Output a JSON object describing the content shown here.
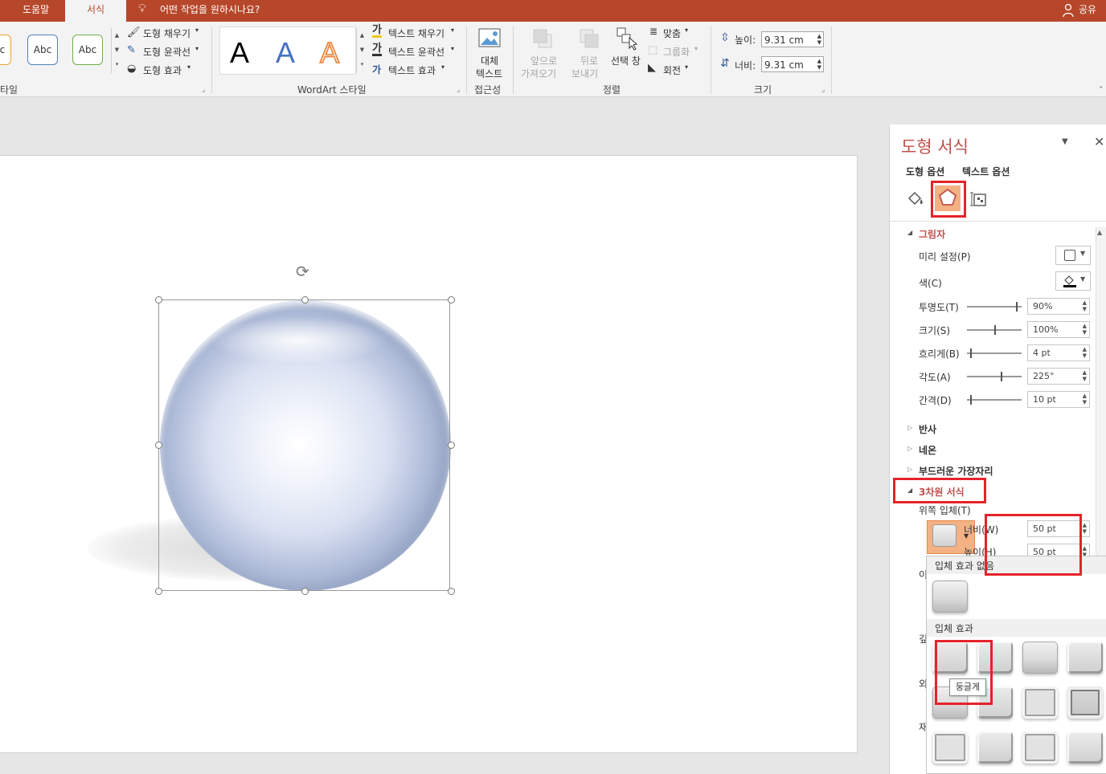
{
  "tabs": [
    "도움말",
    "서식"
  ],
  "search": {
    "placeholder": "어떤 작업을 원하시나요?"
  },
  "share_label": "공유",
  "ribbon": {
    "shape_styles": {
      "style_sample_label": "Abc",
      "fill": "도형 채우기",
      "outline": "도형 윤곽선",
      "effects": "도형 효과",
      "group_label": "타일"
    },
    "wordart": {
      "sample_letter": "A",
      "text_fill": "텍스트 채우기",
      "text_outline": "텍스트 윤곽선",
      "text_effects": "텍스트 효과",
      "group_label": "WordArt 스타일"
    },
    "accessibility": {
      "alt_text_line1": "대체",
      "alt_text_line2": "텍스트",
      "group_label": "접근성"
    },
    "arrange": {
      "bring_forward_line1": "앞으로",
      "bring_forward_line2": "가져오기",
      "send_backward_line1": "뒤로",
      "send_backward_line2": "보내기",
      "selection_pane": "선택 창",
      "align": "맞춤",
      "group": "그룹화",
      "rotate": "회전",
      "group_label": "정렬"
    },
    "size": {
      "height_label": "높이:",
      "height_value": "9.31 cm",
      "width_label": "너비:",
      "width_value": "9.31 cm",
      "group_label": "크기"
    }
  },
  "pane": {
    "title": "도형 서식",
    "tab_shape_options": "도형 옵션",
    "tab_text_options": "텍스트 옵션",
    "shadow": {
      "heading": "그림자",
      "preset_label": "미리 설정(P)",
      "color_label": "색(C)",
      "transparency_label": "투명도(T)",
      "transparency_value": "90%",
      "size_label": "크기(S)",
      "size_value": "100%",
      "blur_label": "흐리게(B)",
      "blur_value": "4 pt",
      "angle_label": "각도(A)",
      "angle_value": "225°",
      "distance_label": "간격(D)",
      "distance_value": "10 pt"
    },
    "reflection": "반사",
    "glow": "네온",
    "soft_edges": "부드러운 가장자리",
    "format_3d": "3차원 서식",
    "top_bevel_label": "위쪽 입체(T)",
    "bevel_width_label": "너비(W)",
    "bevel_width_value": "50 pt",
    "bevel_height_label": "높이(H)",
    "bevel_height_value": "50 pt",
    "gallery": {
      "no_bevel": "입체 효과 없음",
      "bevel_heading": "입체 효과",
      "tooltip": "둥글게"
    }
  }
}
